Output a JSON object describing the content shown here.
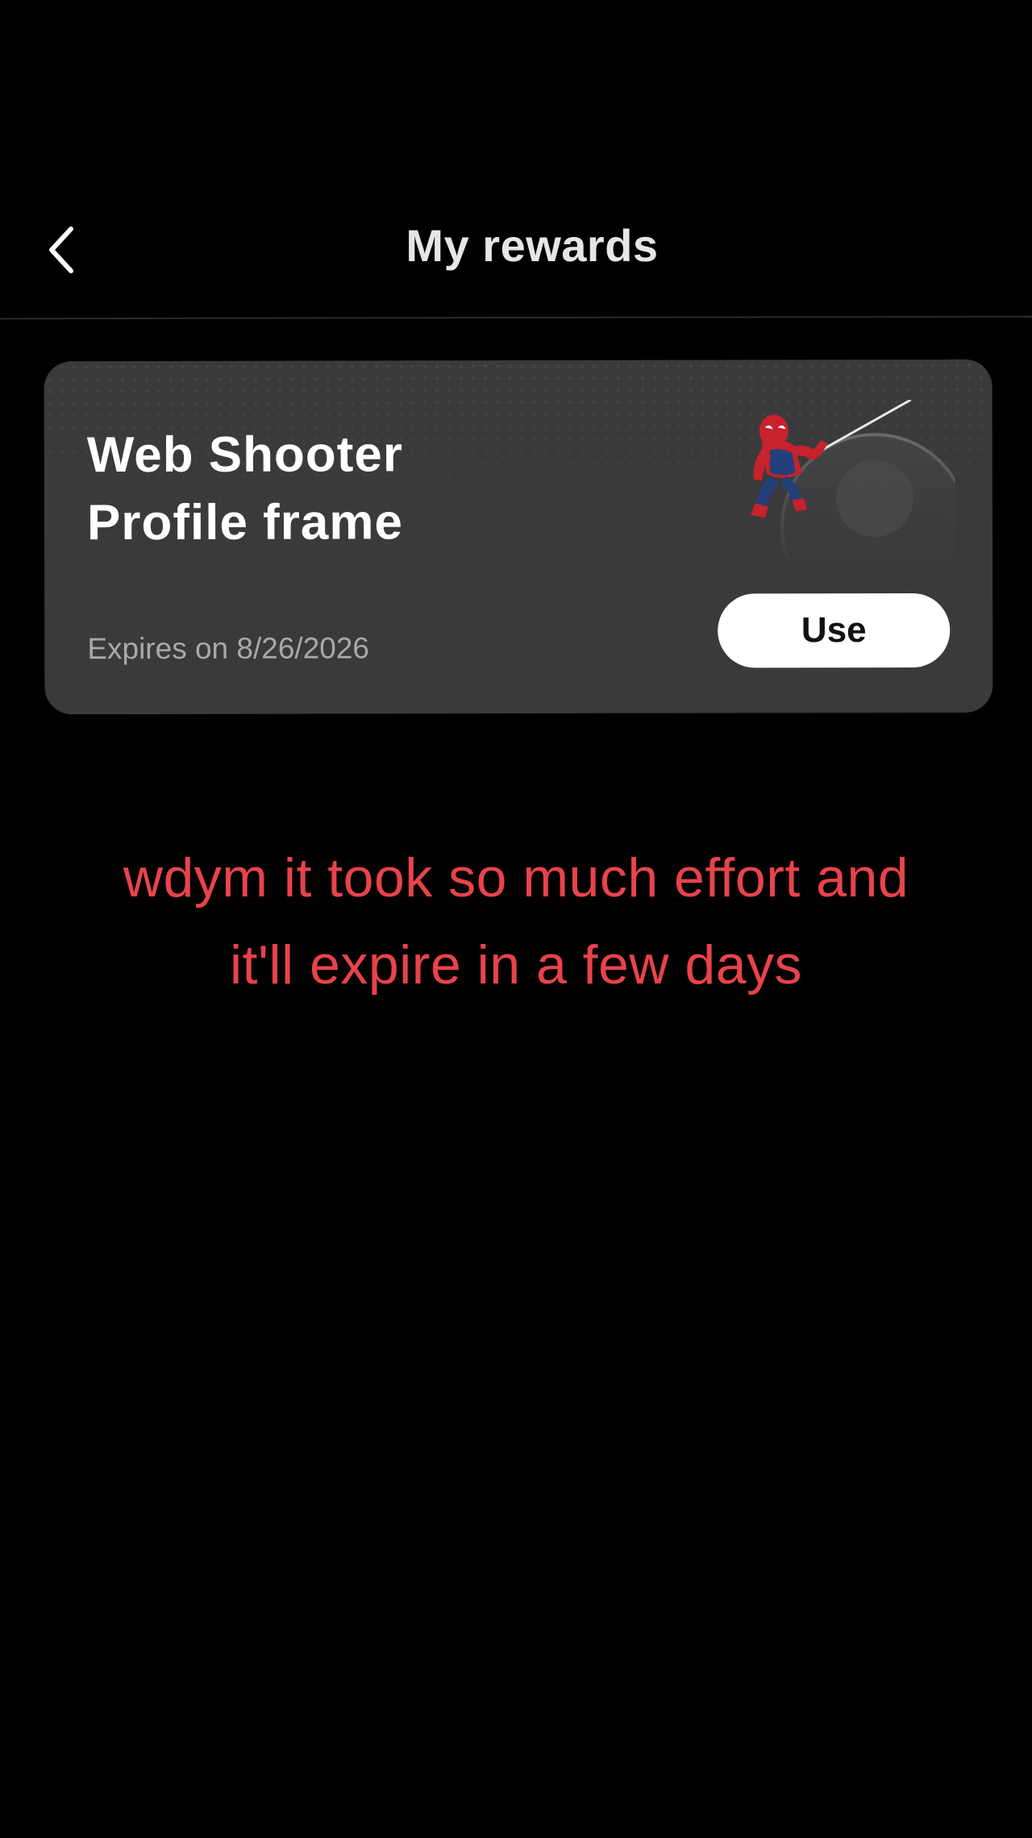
{
  "header": {
    "title": "My rewards"
  },
  "reward_card": {
    "title": "Web Shooter\nProfile frame",
    "expiry": "Expires on 8/26/2026",
    "action_label": "Use",
    "preview_icon": "spider-man-profile-frame-icon"
  },
  "caption": {
    "text": "wdym it took so much effort and\nit'll expire in a few days"
  },
  "colors": {
    "background": "#000000",
    "card": "#3a3a3c",
    "caption": "#e8434b",
    "button": "#ffffff"
  }
}
